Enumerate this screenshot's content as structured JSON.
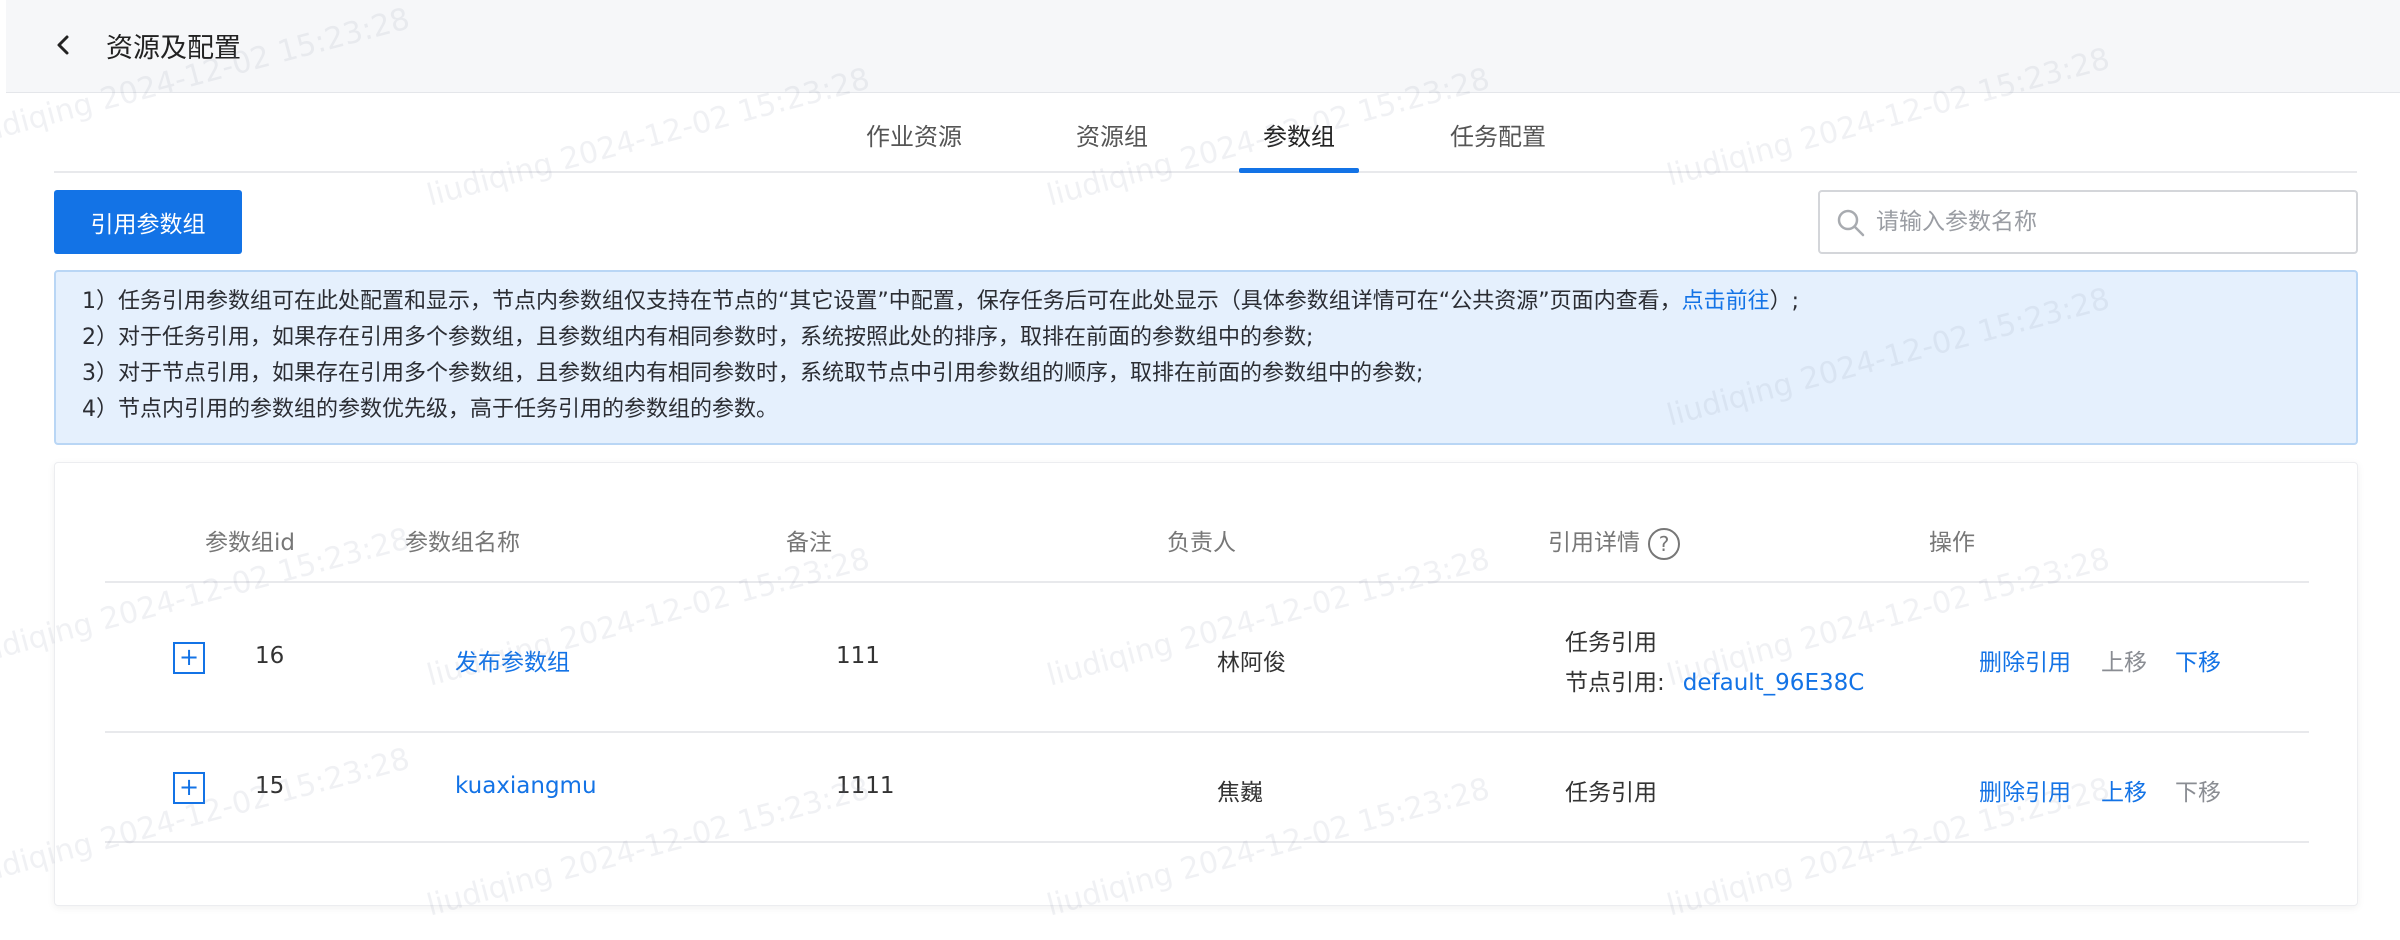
{
  "header": {
    "title": "资源及配置"
  },
  "tabs": [
    {
      "label": "作业资源"
    },
    {
      "label": "资源组"
    },
    {
      "label": "参数组"
    },
    {
      "label": "任务配置"
    }
  ],
  "active_tab": "参数组",
  "toolbar": {
    "reference_button": "引用参数组",
    "search_placeholder": "请输入参数名称"
  },
  "notice": {
    "line1_text": "1）任务引用参数组可在此处配置和显示，节点内参数组仅支持在节点的“其它设置”中配置，保存任务后可在此处显示（具体参数组详情可在“公共资源”页面内查看，",
    "line1_link": "点击前往",
    "line1_end": "）;",
    "line2": "2）对于任务引用，如果存在引用多个参数组，且参数组内有相同参数时，系统按照此处的排序，取排在前面的参数组中的参数;",
    "line3": "3）对于节点引用，如果存在引用多个参数组，且参数组内有相同参数时，系统取节点中引用参数组的顺序，取排在前面的参数组中的参数;",
    "line4": "4）节点内引用的参数组的参数优先级，高于任务引用的参数组的参数。"
  },
  "table": {
    "columns": {
      "id": "参数组id",
      "name": "参数组名称",
      "remark": "备注",
      "owner": "负责人",
      "ref": "引用详情",
      "ops": "操作"
    },
    "help_glyph": "?",
    "expand_glyph": "+",
    "rows": [
      {
        "id": "16",
        "name": "发布参数组",
        "remark": "111",
        "owner": "林阿俊",
        "ref_task": "任务引用",
        "ref_node_label": "节点引用:",
        "ref_node_value": "default_96E38C",
        "op_delete": "删除引用",
        "op_up": "上移",
        "op_down": "下移",
        "up_enabled": false,
        "down_enabled": true
      },
      {
        "id": "15",
        "name": "kuaxiangmu",
        "remark": "1111",
        "owner": "焦巍",
        "ref_task": "任务引用",
        "op_delete": "删除引用",
        "op_up": "上移",
        "op_down": "下移",
        "up_enabled": true,
        "down_enabled": false
      }
    ]
  },
  "watermark": "liudiqing 2024-12-02 15:23:28",
  "colors": {
    "accent": "#1373e6",
    "notice_bg": "#e5f0fd",
    "notice_border": "#b9d6f5"
  }
}
